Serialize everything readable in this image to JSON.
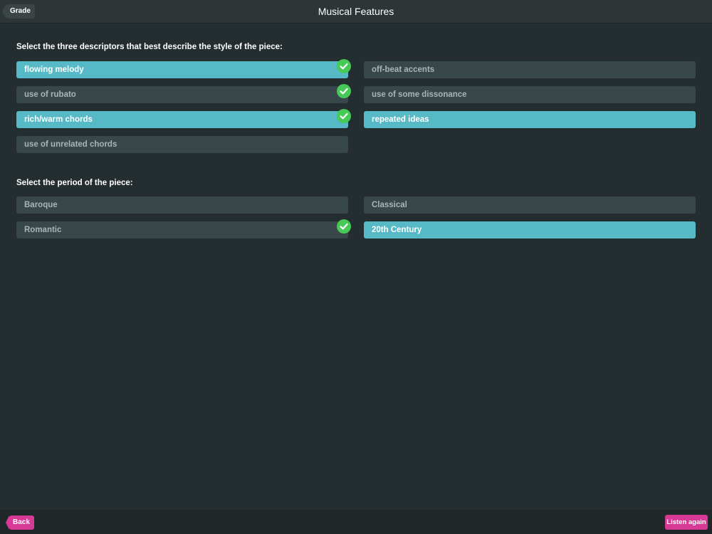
{
  "header": {
    "title": "Musical Features",
    "grade_label": "Grade"
  },
  "descriptors": {
    "prompt": "Select the three descriptors that best describe the style of the piece:",
    "options": [
      {
        "label": "flowing melody",
        "selected": true,
        "correct": true
      },
      {
        "label": "off-beat accents",
        "selected": false,
        "correct": false
      },
      {
        "label": "use of rubato",
        "selected": false,
        "correct": true
      },
      {
        "label": "use of some dissonance",
        "selected": false,
        "correct": false
      },
      {
        "label": "rich/warm chords",
        "selected": true,
        "correct": true
      },
      {
        "label": "repeated ideas",
        "selected": true,
        "correct": false
      },
      {
        "label": "use of unrelated chords",
        "selected": false,
        "correct": false
      }
    ]
  },
  "period": {
    "prompt": "Select the period of the piece:",
    "options": [
      {
        "label": "Baroque",
        "selected": false,
        "correct": false
      },
      {
        "label": "Classical",
        "selected": false,
        "correct": false
      },
      {
        "label": "Romantic",
        "selected": false,
        "correct": true
      },
      {
        "label": "20th Century",
        "selected": true,
        "correct": false
      }
    ]
  },
  "footer": {
    "back_label": "Back",
    "listen_label": "Listen again"
  },
  "colors": {
    "background": "#242d2f",
    "option_default": "#38474a",
    "option_selected": "#56b9c5",
    "check": "#46c956",
    "accent_pink": "#d63a95"
  },
  "icons": {
    "check": "check-circle-icon",
    "back": "chevron-left-icon"
  }
}
